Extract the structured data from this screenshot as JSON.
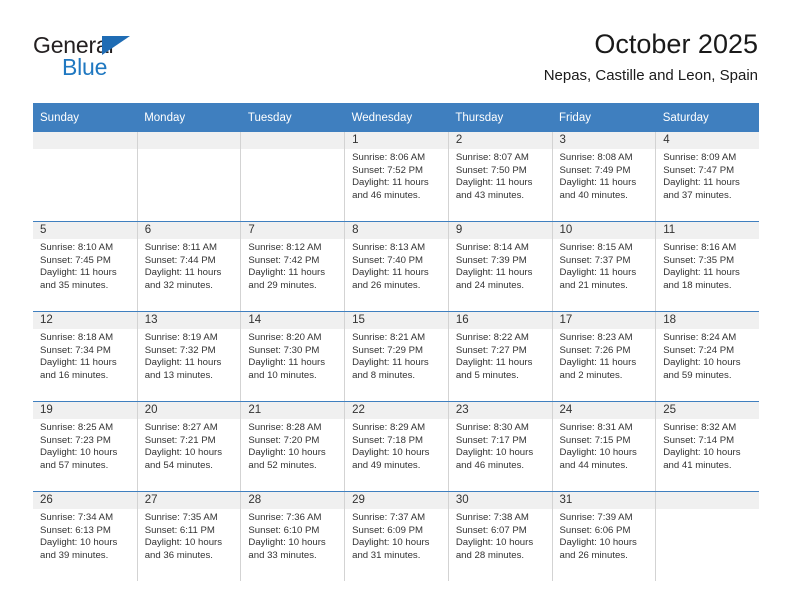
{
  "brand": {
    "name_top": "General",
    "name_bottom": "Blue",
    "accent_color": "#1f78c1",
    "triangle_color": "#1f6cb4"
  },
  "header": {
    "title": "October 2025",
    "subtitle": "Nepas, Castille and Leon, Spain"
  },
  "theme": {
    "header_row_bg": "#3f7fbf",
    "header_row_text": "#ffffff",
    "date_band_bg": "#f0f0f0",
    "cell_bg": "#ffffff",
    "grid_line": "#3f7fbf",
    "cell_divider": "#d3d3d3",
    "body_text": "#333333"
  },
  "weekday_headers": [
    "Sunday",
    "Monday",
    "Tuesday",
    "Wednesday",
    "Thursday",
    "Friday",
    "Saturday"
  ],
  "labels": {
    "sunrise_prefix": "Sunrise:",
    "sunset_prefix": "Sunset:",
    "daylight_prefix": "Daylight:"
  },
  "weeks": [
    [
      {
        "date": "",
        "empty": true
      },
      {
        "date": "",
        "empty": true
      },
      {
        "date": "",
        "empty": true
      },
      {
        "date": "1",
        "sunrise": "Sunrise: 8:06 AM",
        "sunset": "Sunset: 7:52 PM",
        "daylight_l1": "Daylight: 11 hours",
        "daylight_l2": "and 46 minutes."
      },
      {
        "date": "2",
        "sunrise": "Sunrise: 8:07 AM",
        "sunset": "Sunset: 7:50 PM",
        "daylight_l1": "Daylight: 11 hours",
        "daylight_l2": "and 43 minutes."
      },
      {
        "date": "3",
        "sunrise": "Sunrise: 8:08 AM",
        "sunset": "Sunset: 7:49 PM",
        "daylight_l1": "Daylight: 11 hours",
        "daylight_l2": "and 40 minutes."
      },
      {
        "date": "4",
        "sunrise": "Sunrise: 8:09 AM",
        "sunset": "Sunset: 7:47 PM",
        "daylight_l1": "Daylight: 11 hours",
        "daylight_l2": "and 37 minutes."
      }
    ],
    [
      {
        "date": "5",
        "sunrise": "Sunrise: 8:10 AM",
        "sunset": "Sunset: 7:45 PM",
        "daylight_l1": "Daylight: 11 hours",
        "daylight_l2": "and 35 minutes."
      },
      {
        "date": "6",
        "sunrise": "Sunrise: 8:11 AM",
        "sunset": "Sunset: 7:44 PM",
        "daylight_l1": "Daylight: 11 hours",
        "daylight_l2": "and 32 minutes."
      },
      {
        "date": "7",
        "sunrise": "Sunrise: 8:12 AM",
        "sunset": "Sunset: 7:42 PM",
        "daylight_l1": "Daylight: 11 hours",
        "daylight_l2": "and 29 minutes."
      },
      {
        "date": "8",
        "sunrise": "Sunrise: 8:13 AM",
        "sunset": "Sunset: 7:40 PM",
        "daylight_l1": "Daylight: 11 hours",
        "daylight_l2": "and 26 minutes."
      },
      {
        "date": "9",
        "sunrise": "Sunrise: 8:14 AM",
        "sunset": "Sunset: 7:39 PM",
        "daylight_l1": "Daylight: 11 hours",
        "daylight_l2": "and 24 minutes."
      },
      {
        "date": "10",
        "sunrise": "Sunrise: 8:15 AM",
        "sunset": "Sunset: 7:37 PM",
        "daylight_l1": "Daylight: 11 hours",
        "daylight_l2": "and 21 minutes."
      },
      {
        "date": "11",
        "sunrise": "Sunrise: 8:16 AM",
        "sunset": "Sunset: 7:35 PM",
        "daylight_l1": "Daylight: 11 hours",
        "daylight_l2": "and 18 minutes."
      }
    ],
    [
      {
        "date": "12",
        "sunrise": "Sunrise: 8:18 AM",
        "sunset": "Sunset: 7:34 PM",
        "daylight_l1": "Daylight: 11 hours",
        "daylight_l2": "and 16 minutes."
      },
      {
        "date": "13",
        "sunrise": "Sunrise: 8:19 AM",
        "sunset": "Sunset: 7:32 PM",
        "daylight_l1": "Daylight: 11 hours",
        "daylight_l2": "and 13 minutes."
      },
      {
        "date": "14",
        "sunrise": "Sunrise: 8:20 AM",
        "sunset": "Sunset: 7:30 PM",
        "daylight_l1": "Daylight: 11 hours",
        "daylight_l2": "and 10 minutes."
      },
      {
        "date": "15",
        "sunrise": "Sunrise: 8:21 AM",
        "sunset": "Sunset: 7:29 PM",
        "daylight_l1": "Daylight: 11 hours",
        "daylight_l2": "and 8 minutes."
      },
      {
        "date": "16",
        "sunrise": "Sunrise: 8:22 AM",
        "sunset": "Sunset: 7:27 PM",
        "daylight_l1": "Daylight: 11 hours",
        "daylight_l2": "and 5 minutes."
      },
      {
        "date": "17",
        "sunrise": "Sunrise: 8:23 AM",
        "sunset": "Sunset: 7:26 PM",
        "daylight_l1": "Daylight: 11 hours",
        "daylight_l2": "and 2 minutes."
      },
      {
        "date": "18",
        "sunrise": "Sunrise: 8:24 AM",
        "sunset": "Sunset: 7:24 PM",
        "daylight_l1": "Daylight: 10 hours",
        "daylight_l2": "and 59 minutes."
      }
    ],
    [
      {
        "date": "19",
        "sunrise": "Sunrise: 8:25 AM",
        "sunset": "Sunset: 7:23 PM",
        "daylight_l1": "Daylight: 10 hours",
        "daylight_l2": "and 57 minutes."
      },
      {
        "date": "20",
        "sunrise": "Sunrise: 8:27 AM",
        "sunset": "Sunset: 7:21 PM",
        "daylight_l1": "Daylight: 10 hours",
        "daylight_l2": "and 54 minutes."
      },
      {
        "date": "21",
        "sunrise": "Sunrise: 8:28 AM",
        "sunset": "Sunset: 7:20 PM",
        "daylight_l1": "Daylight: 10 hours",
        "daylight_l2": "and 52 minutes."
      },
      {
        "date": "22",
        "sunrise": "Sunrise: 8:29 AM",
        "sunset": "Sunset: 7:18 PM",
        "daylight_l1": "Daylight: 10 hours",
        "daylight_l2": "and 49 minutes."
      },
      {
        "date": "23",
        "sunrise": "Sunrise: 8:30 AM",
        "sunset": "Sunset: 7:17 PM",
        "daylight_l1": "Daylight: 10 hours",
        "daylight_l2": "and 46 minutes."
      },
      {
        "date": "24",
        "sunrise": "Sunrise: 8:31 AM",
        "sunset": "Sunset: 7:15 PM",
        "daylight_l1": "Daylight: 10 hours",
        "daylight_l2": "and 44 minutes."
      },
      {
        "date": "25",
        "sunrise": "Sunrise: 8:32 AM",
        "sunset": "Sunset: 7:14 PM",
        "daylight_l1": "Daylight: 10 hours",
        "daylight_l2": "and 41 minutes."
      }
    ],
    [
      {
        "date": "26",
        "sunrise": "Sunrise: 7:34 AM",
        "sunset": "Sunset: 6:13 PM",
        "daylight_l1": "Daylight: 10 hours",
        "daylight_l2": "and 39 minutes."
      },
      {
        "date": "27",
        "sunrise": "Sunrise: 7:35 AM",
        "sunset": "Sunset: 6:11 PM",
        "daylight_l1": "Daylight: 10 hours",
        "daylight_l2": "and 36 minutes."
      },
      {
        "date": "28",
        "sunrise": "Sunrise: 7:36 AM",
        "sunset": "Sunset: 6:10 PM",
        "daylight_l1": "Daylight: 10 hours",
        "daylight_l2": "and 33 minutes."
      },
      {
        "date": "29",
        "sunrise": "Sunrise: 7:37 AM",
        "sunset": "Sunset: 6:09 PM",
        "daylight_l1": "Daylight: 10 hours",
        "daylight_l2": "and 31 minutes."
      },
      {
        "date": "30",
        "sunrise": "Sunrise: 7:38 AM",
        "sunset": "Sunset: 6:07 PM",
        "daylight_l1": "Daylight: 10 hours",
        "daylight_l2": "and 28 minutes."
      },
      {
        "date": "31",
        "sunrise": "Sunrise: 7:39 AM",
        "sunset": "Sunset: 6:06 PM",
        "daylight_l1": "Daylight: 10 hours",
        "daylight_l2": "and 26 minutes."
      },
      {
        "date": "",
        "empty": true
      }
    ]
  ]
}
